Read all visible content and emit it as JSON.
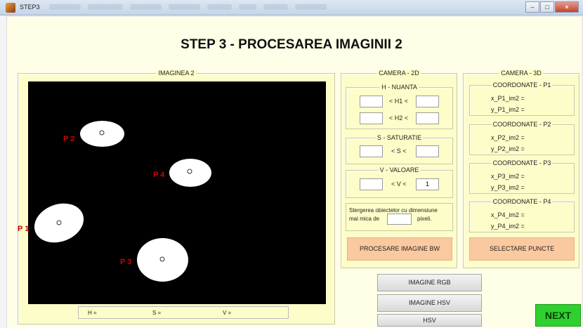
{
  "window": {
    "title": "STEP3",
    "minimize": "–",
    "maximize": "□",
    "close": "×"
  },
  "header": {
    "title": "STEP 3 - PROCESAREA IMAGINII 2"
  },
  "image_panel": {
    "legend": "IMAGINEA 2",
    "points": [
      {
        "label": "P 2"
      },
      {
        "label": "P 4"
      },
      {
        "label": "P 1"
      },
      {
        "label": "P 3"
      }
    ],
    "hsv_readout": {
      "h": "H =",
      "s": "S =",
      "v": "V ="
    }
  },
  "camera2d": {
    "legend": "CAMERA - 2D",
    "h_legend": "H - NUANTA",
    "h1": "< H1 <",
    "h2": "< H2 <",
    "s_legend": "S - SATURATIE",
    "s": "< S <",
    "v_legend": "V - VALOARE",
    "v": "< V <",
    "v_value": "1",
    "remove_text_1": "Stergerea obiectelor cu dimensiune",
    "remove_text_2": "mai mica de",
    "remove_unit": "pixeli.",
    "process_button": "PROCESARE IMAGINE BW"
  },
  "camera3d": {
    "legend": "CAMERA - 3D",
    "groups": [
      {
        "legend": "COORDONATE - P1",
        "x": "x_P1_im2 =",
        "y": "y_P1_im2 ="
      },
      {
        "legend": "COORDONATE - P2",
        "x": "x_P2_im2 =",
        "y": "y_P2_im2 ="
      },
      {
        "legend": "COORDONATE - P3",
        "x": "x_P3_im2 =",
        "y": "y_P3_im2 ="
      },
      {
        "legend": "COORDONATE - P4",
        "x": "x_P4_im2 =",
        "y": "y_P4_im2 ="
      }
    ],
    "select_button": "SELECTARE PUNCTE"
  },
  "buttons": {
    "rgb": "IMAGINE RGB",
    "hsv_image": "IMAGINE HSV",
    "hsv": "HSV",
    "next": "NEXT"
  },
  "colors": {
    "panel": "#fdfdc9",
    "orange_button": "#fbc9a0",
    "next_button": "#2ed12e",
    "point_label": "#d40000"
  }
}
